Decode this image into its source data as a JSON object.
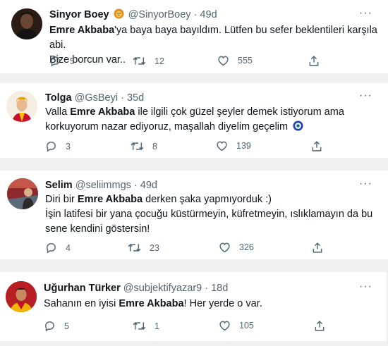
{
  "tweets": [
    {
      "name": "Sinyor Boey",
      "handle": "@SinyorBoey",
      "time": "· 49d",
      "line1_bold": "Emre Akbaba",
      "line1_rest": "'ya baya baya bayıldım. Lütfen bu sefer beklentileri karşıla abi.",
      "line2": "Bize borcun var..",
      "replies": "5",
      "retweets": "12",
      "likes": "555"
    },
    {
      "name": "Tolga",
      "handle": "@GsBeyi",
      "time": "· 35d",
      "line1_pre": "Valla ",
      "line1_bold": "Emre Akbaba",
      "line1_rest": " ile ilgili çok güzel şeyler demek istiyorum ama",
      "line2": "korkuyorum nazar ediyoruz, maşallah diyelim geçelim",
      "replies": "3",
      "retweets": "8",
      "likes": "139"
    },
    {
      "name": "Selim",
      "handle": "@seliimmgs",
      "time": "· 49d",
      "line1_pre": "Diri bir ",
      "line1_bold": "Emre Akbaba",
      "line1_rest": " derken şaka yapmıyorduk :)",
      "line2": "İşin latifesi bir yana çocuğu küstürmeyin, küfretmeyin, ıslıklamayın da bu",
      "line3": "sene kendini göstersin!",
      "replies": "4",
      "retweets": "23",
      "likes": "326"
    },
    {
      "name": "Uğurhan Türker",
      "handle": "@subjektifyazar9",
      "time": "· 18d",
      "line1_pre": "Sahanın en iyisi ",
      "line1_bold": "Emre Akbaba",
      "line1_rest": "! Her yerde o var.",
      "replies": "5",
      "retweets": "1",
      "likes": "105"
    }
  ],
  "icons": {
    "reply": "reply-icon",
    "retweet": "retweet-icon",
    "like": "heart-icon",
    "share": "share-icon",
    "more": "more-options-icon"
  }
}
